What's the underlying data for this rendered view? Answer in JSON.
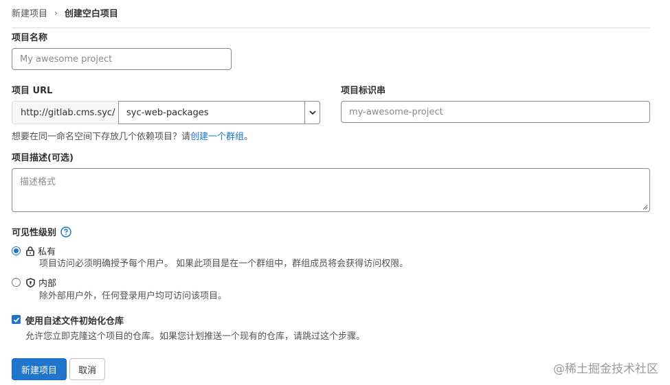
{
  "breadcrumb": {
    "parent": "新建项目",
    "separator": "›",
    "current": "创建空白项目"
  },
  "project_name": {
    "label": "项目名称",
    "placeholder": "My awesome project"
  },
  "project_url": {
    "label": "项目 URL",
    "prefix": "http://gitlab.cms.syc/",
    "namespace": "syc-web-packages"
  },
  "project_slug": {
    "label": "项目标识串",
    "placeholder": "my-awesome-project"
  },
  "group_help": {
    "text": "想要在同一命名空间下存放几个依赖项目？请",
    "link": "创建一个群组",
    "suffix": "。"
  },
  "description": {
    "label": "项目描述(可选)",
    "placeholder": "描述格式"
  },
  "visibility": {
    "label": "可见性级别",
    "options": [
      {
        "title": "私有",
        "desc": "项目访问必须明确授予每个用户。 如果此项目是在一个群组中，群组成员将会获得访问权限。",
        "icon": "lock-icon",
        "selected": true
      },
      {
        "title": "内部",
        "desc": "除外部用户外，任何登录用户均可访问该项目。",
        "icon": "shield-icon",
        "selected": false
      }
    ]
  },
  "readme": {
    "label": "使用自述文件初始化仓库",
    "desc": "允许您立即克隆这个项目的仓库。如果您计划推送一个现有的仓库，请跳过这个步骤。",
    "checked": true
  },
  "actions": {
    "create": "新建项目",
    "cancel": "取消"
  },
  "watermark": "@稀土掘金技术社区",
  "colors": {
    "primary": "#1f75cb",
    "link": "#1f75cb"
  }
}
